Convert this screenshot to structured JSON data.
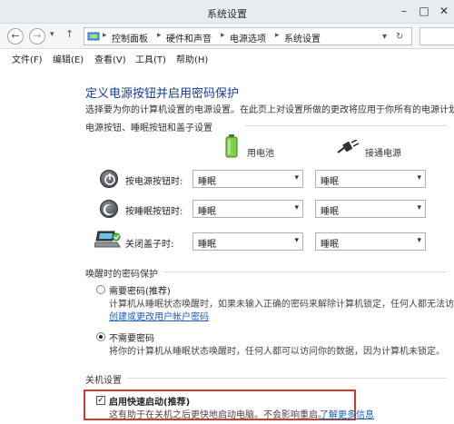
{
  "window": {
    "title": "系统设置"
  },
  "nav": {
    "back_icon": "back-arrow-icon",
    "forward_icon": "forward-arrow-icon",
    "up_icon": "up-arrow-icon"
  },
  "address": {
    "crumbs": [
      "控制面板",
      "硬件和声音",
      "电源选项",
      "系统设置"
    ]
  },
  "menu": {
    "items": [
      "文件(F)",
      "编辑(E)",
      "查看(V)",
      "工具(T)",
      "帮助(H)"
    ]
  },
  "page": {
    "heading": "定义电源按钮并启用密码保护",
    "subtitle": "选择要为你的计算机设置的电源设置。在此页上对设置所做的更改将应用于你所有的电源计划。"
  },
  "power_section": {
    "label": "电源按钮、睡眠按钮和盖子设置",
    "columns": [
      "用电池",
      "接通电源"
    ],
    "rows": [
      {
        "label": "按电源按钮时:",
        "battery": "睡眠",
        "plugged": "睡眠",
        "icon": "power-button-icon"
      },
      {
        "label": "按睡眠按钮时:",
        "battery": "睡眠",
        "plugged": "睡眠",
        "icon": "sleep-button-icon"
      },
      {
        "label": "关闭盖子时:",
        "battery": "睡眠",
        "plugged": "睡眠",
        "icon": "laptop-lid-icon"
      }
    ]
  },
  "password_section": {
    "label": "唤醒时的密码保护",
    "options": [
      {
        "label": "需要密码(推荐)",
        "checked": false,
        "desc": "计算机从睡眠状态唤醒时，如果未输入正确的密码来解除计算机锁定，任何人都无法访问",
        "link": "创建或更改用户帐户密码"
      },
      {
        "label": "不需要密码",
        "checked": true,
        "desc": "将你的计算机从睡眠状态唤醒时，任何人都可以访问你的数据，因为计算机未锁定。",
        "link": ""
      }
    ]
  },
  "shutdown_section": {
    "label": "关机设置",
    "fast_startup": {
      "label": "启用快速启动(推荐)",
      "checked": true,
      "desc": "这有助于在关机之后更快地启动电脑。不会影响重启。",
      "link": "了解更多信息"
    }
  }
}
